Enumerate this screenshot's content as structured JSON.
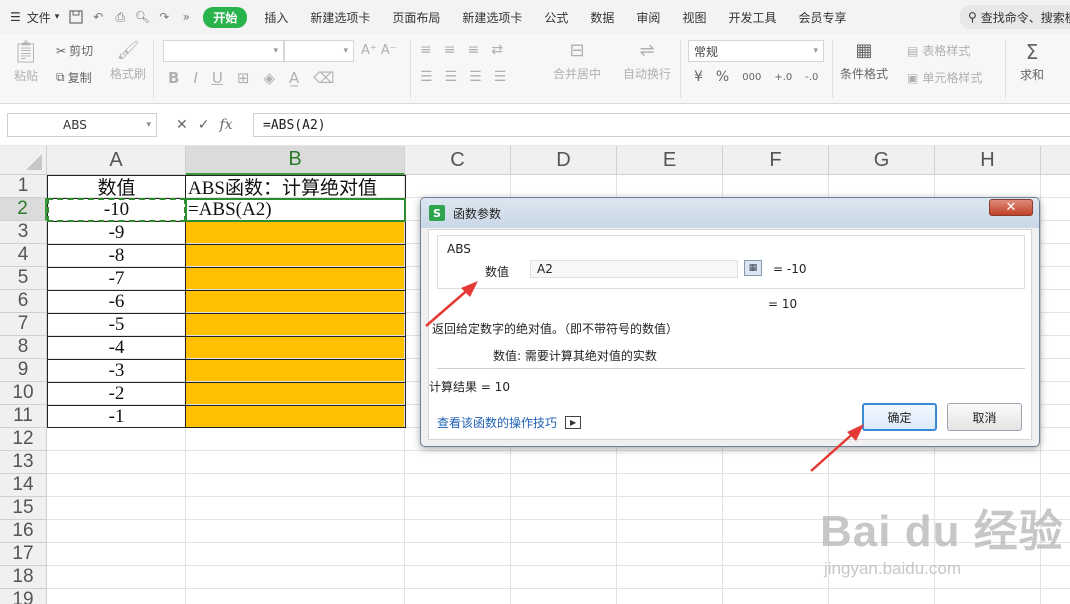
{
  "menubar": {
    "file_label": "文件",
    "tabs": [
      "插入",
      "新建选项卡",
      "页面布局",
      "新建选项卡",
      "公式",
      "数据",
      "审阅",
      "视图",
      "开发工具",
      "会员专享"
    ],
    "active_tab": "开始",
    "search_placeholder": "查找命令、搜索模板"
  },
  "ribbon": {
    "paste": "粘贴",
    "cut": "剪切",
    "copy": "复制",
    "format_painter": "格式刷",
    "merge_center": "合并居中",
    "wrap_text": "自动换行",
    "number_format": "常规",
    "conditional_format": "条件格式",
    "table_style": "表格样式",
    "cell_style": "单元格样式",
    "sum": "求和",
    "bold": "B",
    "italic": "I",
    "underline": "U",
    "currency": "¥",
    "percent": "%"
  },
  "formula_bar": {
    "name_box": "ABS",
    "fx": "fx",
    "formula": "=ABS(A2)"
  },
  "sheet": {
    "columns": [
      "A",
      "B",
      "C",
      "D",
      "E",
      "F",
      "G",
      "H"
    ],
    "rows": [
      "1",
      "2",
      "3",
      "4",
      "5",
      "6",
      "7",
      "8",
      "9",
      "10",
      "11",
      "12",
      "13",
      "14",
      "15",
      "16",
      "17",
      "18",
      "19"
    ],
    "a_values": [
      "数值",
      "-10",
      "-9",
      "-8",
      "-7",
      "-6",
      "-5",
      "-4",
      "-3",
      "-2",
      "-1"
    ],
    "b1": "ABS函数：计算绝对值",
    "b2": "=ABS(A2)"
  },
  "dialog": {
    "title": "函数参数",
    "function_name": "ABS",
    "arg_label": "数值",
    "arg_value": "A2",
    "arg_result": "= -10",
    "result_preview": "= 10",
    "description": "返回给定数字的绝对值。（即不带符号的数值）",
    "param_help": "数值:  需要计算其绝对值的实数",
    "calc_result": "计算结果 = 10",
    "help_link": "查看该函数的操作技巧",
    "ok": "确定",
    "cancel": "取消"
  },
  "watermark": {
    "main": "Bai du 经验",
    "sub": "jingyan.baidu.com"
  },
  "colors": {
    "accent": "#28b34d",
    "highlight": "#ffc000",
    "annotation": "#e53935"
  }
}
